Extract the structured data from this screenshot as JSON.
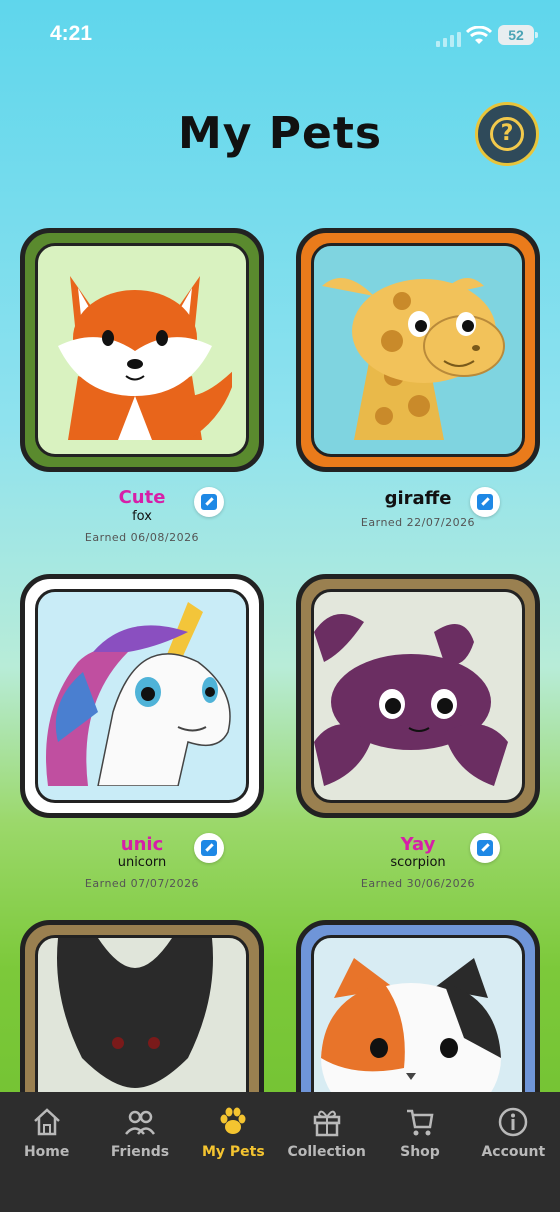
{
  "status": {
    "time": "4:21",
    "battery": "52"
  },
  "header": {
    "title": "My Pets"
  },
  "pets": [
    {
      "name": "Cute",
      "species": "fox",
      "earned": "Earned 06/08/2026",
      "name_color": "#d61fa8",
      "frame_color": "#5a8a2e",
      "bg": "#d9f2c0"
    },
    {
      "name": "giraffe",
      "species": "",
      "earned": "Earned 22/07/2026",
      "name_color": "#111111",
      "frame_color": "#ea7b1b",
      "bg": "#7fd4e0"
    },
    {
      "name": "unic",
      "species": "unicorn",
      "earned": "Earned 07/07/2026",
      "name_color": "#d61fa8",
      "frame_color": "#ffffff",
      "bg": "#c9ecf7"
    },
    {
      "name": "Yay",
      "species": "scorpion",
      "earned": "Earned 30/06/2026",
      "name_color": "#d61fa8",
      "frame_color": "#9a8050",
      "bg": "#e3e7dc"
    },
    {
      "name": "",
      "species": "",
      "earned": "",
      "name_color": "#111111",
      "frame_color": "#9a8050",
      "bg": "#e0e5da"
    },
    {
      "name": "",
      "species": "",
      "earned": "",
      "name_color": "#111111",
      "frame_color": "#6f95d8",
      "bg": "#d8ecf3"
    }
  ],
  "nav": {
    "items": [
      {
        "label": "Home",
        "icon": "home-icon"
      },
      {
        "label": "Friends",
        "icon": "friends-icon"
      },
      {
        "label": "My Pets",
        "icon": "paw-icon"
      },
      {
        "label": "Collection",
        "icon": "gift-icon"
      },
      {
        "label": "Shop",
        "icon": "cart-icon"
      },
      {
        "label": "Account",
        "icon": "info-icon"
      }
    ],
    "active": "My Pets",
    "active_color": "#f4c430"
  }
}
